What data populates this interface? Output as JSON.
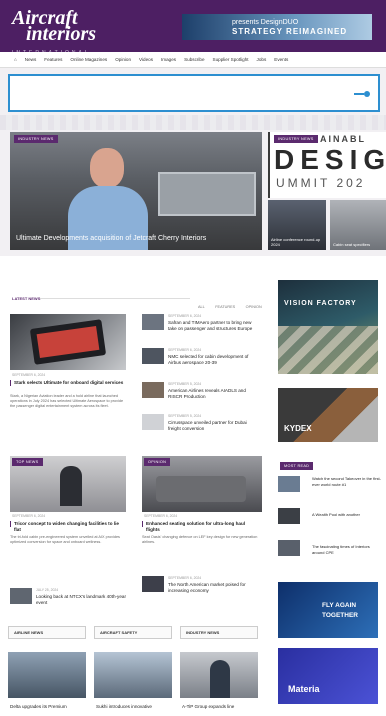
{
  "header": {
    "logo_line1": "Aircraft",
    "logo_line2": "interiors",
    "logo_sub": "INTERNATIONAL",
    "ad_line1": "presents DesignDUO",
    "ad_line2": "STRATEGY REIMAGINED"
  },
  "nav": [
    "⌂",
    "News",
    "Features",
    "Online Magazines",
    "Opinion",
    "Videos",
    "Images",
    "Subscribe",
    "Supplier Spotlight",
    "Jobs",
    "Events"
  ],
  "hero": {
    "badge": "INDUSTRY NEWS",
    "caption": "Ultimate Developments acquisition of Jetcraft Cherry Interiors"
  },
  "design_banner": {
    "badge": "INDUSTRY NEWS",
    "top": "AINABL",
    "word": "DESIGN",
    "bottom": "UMMIT 202"
  },
  "side_thumbs": [
    {
      "title": "Airline conference round-up 2024"
    },
    {
      "title": "Cabin seat specifiers"
    }
  ],
  "latest": {
    "heading": "LATEST NEWS",
    "tabs": [
      "ALL",
      "FEATURES",
      "OPINION"
    ],
    "feature": {
      "date": "SEPTEMBER 6, 2024",
      "title": "Stark selects Ultimate for onboard digital services",
      "body": "Stark, a Nigerian Aviation leader and a hold airline that launched operations in July 2024 has selected Ultimate Aerospace to provide the passenger digital entertainment system across its fleet."
    },
    "items": [
      {
        "date": "SEPTEMBER 6, 2024",
        "title": "Safran and TIMAero partner to bring new take on passenger and structures Europe"
      },
      {
        "date": "SEPTEMBER 6, 2024",
        "title": "NMC selected for cabin development of Airbus aerospace 20-39"
      },
      {
        "date": "SEPTEMBER 5, 2024",
        "title": "American Airlines reveals AIADLS and RISCR Production"
      },
      {
        "date": "SEPTEMBER 5, 2024",
        "title": "Cirrusspace unveiled partner for Dubai freight conversion"
      }
    ]
  },
  "mid": {
    "left_badge": "TOP NEWS",
    "left_date": "SEPTEMBER 6, 2024",
    "left_title": "Tricor concept to widen changing facilities to lie flat",
    "left_body": "The tri-fold cabin pre-engineered system unveiled at AIX provides optimized conversion for space and onboard wellness.",
    "right_badge": "OPINION",
    "right_date": "SEPTEMBER 6, 2024",
    "right_title": "Enhanced seating solution for ultra-long haul flights",
    "right_body": "Seat Oasis' changing defence on LEF key design for new generation airlines.",
    "list": [
      {
        "date": "JULY 25, 2024",
        "title": "Looking back at NTCX's landmark 40th-year event"
      },
      {
        "date": "SEPTEMBER 6, 2024",
        "title": "The North American market poised for increasing economy"
      }
    ]
  },
  "bottom": {
    "heads": [
      "AIRLINE NEWS",
      "AIRCRAFT SAFETY",
      "INDUSTRY NEWS"
    ],
    "captions": [
      "Delta upgrades its Premium",
      "Sukhi introduces innovative",
      "A-TiP Group expands line"
    ]
  },
  "right_col": {
    "ad1_title": "VISION FACTORY",
    "ad2_title": "KYDEX",
    "most_read": "MOST READ",
    "most_items": [
      "Watch the second Takeover in the first-ever world route #1",
      "A Wealth Pool with another",
      "The fascinating times of Interiors around CPE"
    ],
    "ad3_line1": "FLY AGAIN",
    "ad3_line2": "TOGETHER",
    "ad4_title": "Materia"
  }
}
